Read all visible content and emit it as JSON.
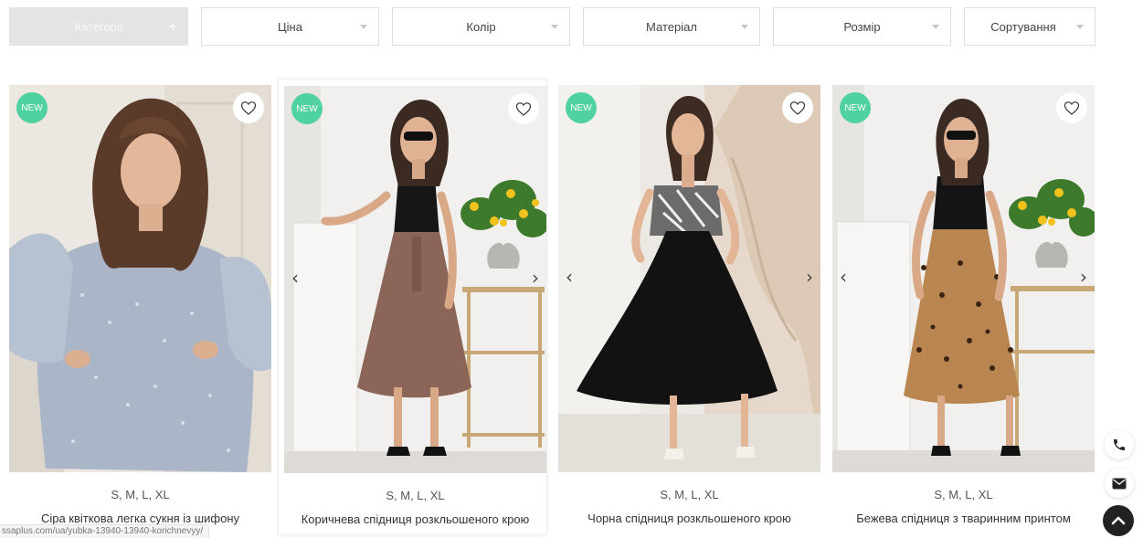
{
  "filters": [
    {
      "label": "Категорії",
      "active": true
    },
    {
      "label": "Ціна",
      "active": false
    },
    {
      "label": "Колір",
      "active": false
    },
    {
      "label": "Матеріал",
      "active": false
    },
    {
      "label": "Розмір",
      "active": false
    },
    {
      "label": "Сортування",
      "active": false
    }
  ],
  "products": [
    {
      "badge": "NEW",
      "sizes": "S, M, L, XL",
      "title": "Сіра квіткова легка сукня із шифону",
      "has_arrows": false
    },
    {
      "badge": "NEW",
      "sizes": "S, M, L, XL",
      "title": "Коричнева спідниця розкльошеного крою",
      "has_arrows": true
    },
    {
      "badge": "NEW",
      "sizes": "S, M, L, XL",
      "title": "Чорна спідниця розкльошеного крою",
      "has_arrows": true
    },
    {
      "badge": "NEW",
      "sizes": "S, M, L, XL",
      "title": "Бежева спідниця з тваринним принтом",
      "has_arrows": true
    }
  ],
  "arrows": {
    "prev": "‹",
    "next": "›"
  },
  "status_bar": {
    "url": "ssaplus.com/ua/yubka-13940-13940-korichnevyy/"
  },
  "colors": {
    "badge": "#4fd1a0",
    "active_filter": "#e4e4e4",
    "scroll_top": "#222222"
  },
  "side_buttons": [
    "phone-icon",
    "mail-icon",
    "scroll-up-icon"
  ]
}
